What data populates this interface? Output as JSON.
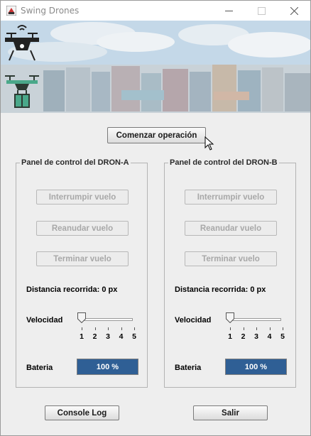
{
  "window": {
    "title": "Swing Drones",
    "controls": {
      "minimize": "minimize-icon",
      "maximize": "maximize-icon",
      "close": "close-icon"
    }
  },
  "banner": {
    "logos": [
      "drone-icon",
      "drone-delivery-icon"
    ],
    "image": "shipping-containers-photo"
  },
  "start_button": "Comenzar operación",
  "panels": [
    {
      "title": "Panel de control del DRON-A",
      "buttons": [
        "Interrumpir vuelo",
        "Reanudar vuelo",
        "Terminar vuelo"
      ],
      "distance": "Distancia recorrida: 0 px",
      "speed_label": "Velocidad",
      "speed_value": 1,
      "speed_ticks": [
        "1",
        "2",
        "3",
        "4",
        "5"
      ],
      "battery_label": "Bateria",
      "battery_text": "100 %",
      "battery_fraction": 1.0
    },
    {
      "title": "Panel de control del DRON-B",
      "buttons": [
        "Interrumpir vuelo",
        "Reanudar vuelo",
        "Terminar vuelo"
      ],
      "distance": "Distancia recorrida: 0 px",
      "speed_label": "Velocidad",
      "speed_value": 1,
      "speed_ticks": [
        "1",
        "2",
        "3",
        "4",
        "5"
      ],
      "battery_label": "Bateria",
      "battery_text": "100 %",
      "battery_fraction": 1.0
    }
  ],
  "footer": {
    "console_button": "Console Log",
    "exit_button": "Salir"
  },
  "colors": {
    "battery_fill": "#2f5f95",
    "logo_dark": "#222222",
    "logo_green": "#4aa88a"
  }
}
